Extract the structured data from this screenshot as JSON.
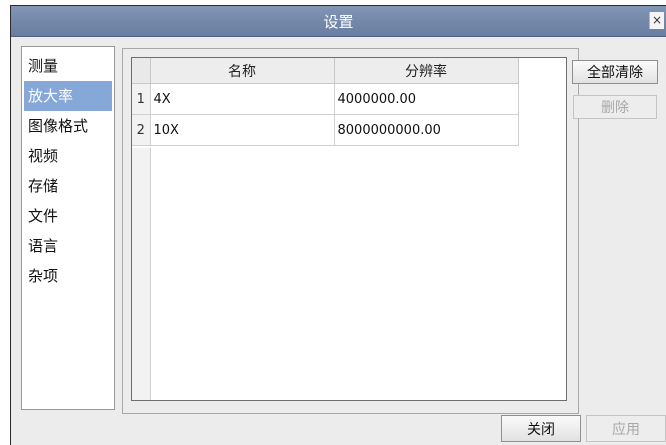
{
  "window": {
    "title": "设置",
    "close_glyph": "×"
  },
  "sidebar": {
    "items": [
      {
        "label": "测量"
      },
      {
        "label": "放大率"
      },
      {
        "label": "图像格式"
      },
      {
        "label": "视频"
      },
      {
        "label": "存储"
      },
      {
        "label": "文件"
      },
      {
        "label": "语言"
      },
      {
        "label": "杂项"
      }
    ],
    "selected": "放大率"
  },
  "table": {
    "columns": [
      "名称",
      "分辨率"
    ],
    "rows": [
      {
        "num": "1",
        "name": "4X",
        "resolution": "4000000.00"
      },
      {
        "num": "2",
        "name": "10X",
        "resolution": "8000000000.00"
      }
    ]
  },
  "buttons": {
    "clear_all": "全部清除",
    "delete": "删除",
    "close": "关闭",
    "apply": "应用"
  },
  "colors": {
    "titlebar": "#7489ab",
    "selected_item": "#86a8d9",
    "dialog_bg": "#ececec"
  }
}
